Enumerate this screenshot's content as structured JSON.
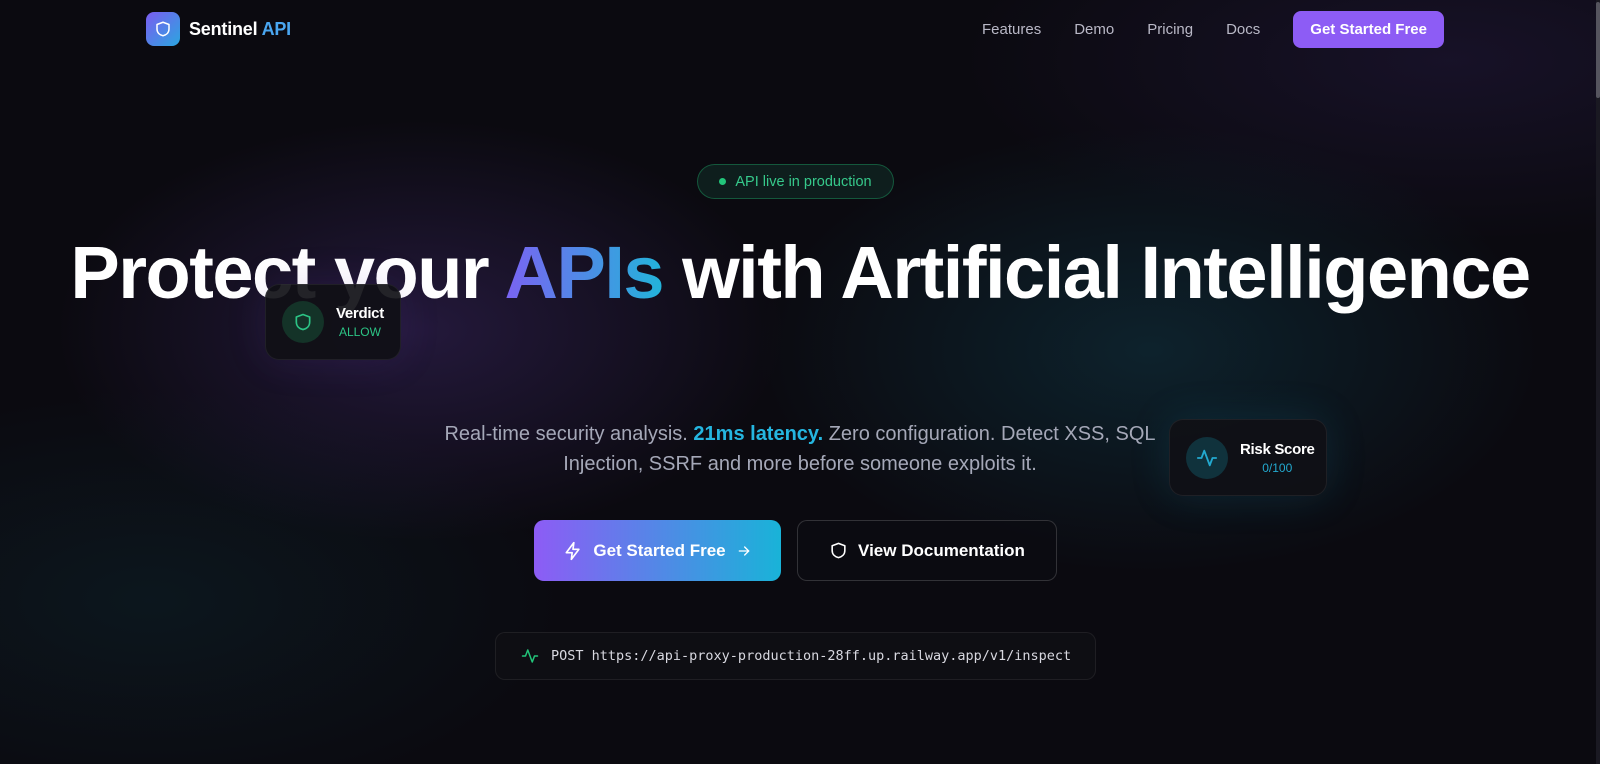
{
  "brand": {
    "name": "Sentinel",
    "accent": "API",
    "logo_icon": "shield-icon"
  },
  "nav": {
    "links": [
      "Features",
      "Demo",
      "Pricing",
      "Docs"
    ],
    "cta_label": "Get Started Free"
  },
  "badge": {
    "label": "API live in production"
  },
  "hero": {
    "headline_part1": "Protect your ",
    "headline_highlight": "APIs",
    "headline_part2": " with Artificial Intelligence",
    "sub_part1": "Real-time security analysis. ",
    "sub_highlight": "21ms latency.",
    "sub_part2": " Zero configuration. Detect XSS, SQL Injection, SSRF and more before someone exploits it."
  },
  "cards": {
    "verdict": {
      "title": "Verdict",
      "value": "ALLOW",
      "icon": "shield-icon"
    },
    "risk": {
      "title": "Risk Score",
      "value": "0/100",
      "icon": "activity-icon"
    }
  },
  "buttons": {
    "primary_label": "Get Started Free",
    "secondary_label": "View Documentation"
  },
  "endpoint": {
    "text": "POST https://api-proxy-production-28ff.up.railway.app/v1/inspect",
    "icon": "activity-icon"
  },
  "colors": {
    "accent_purple": "#8d5cf5",
    "accent_cyan": "#19b3d8",
    "success_green": "#22c57a",
    "background": "#0b0a10"
  }
}
